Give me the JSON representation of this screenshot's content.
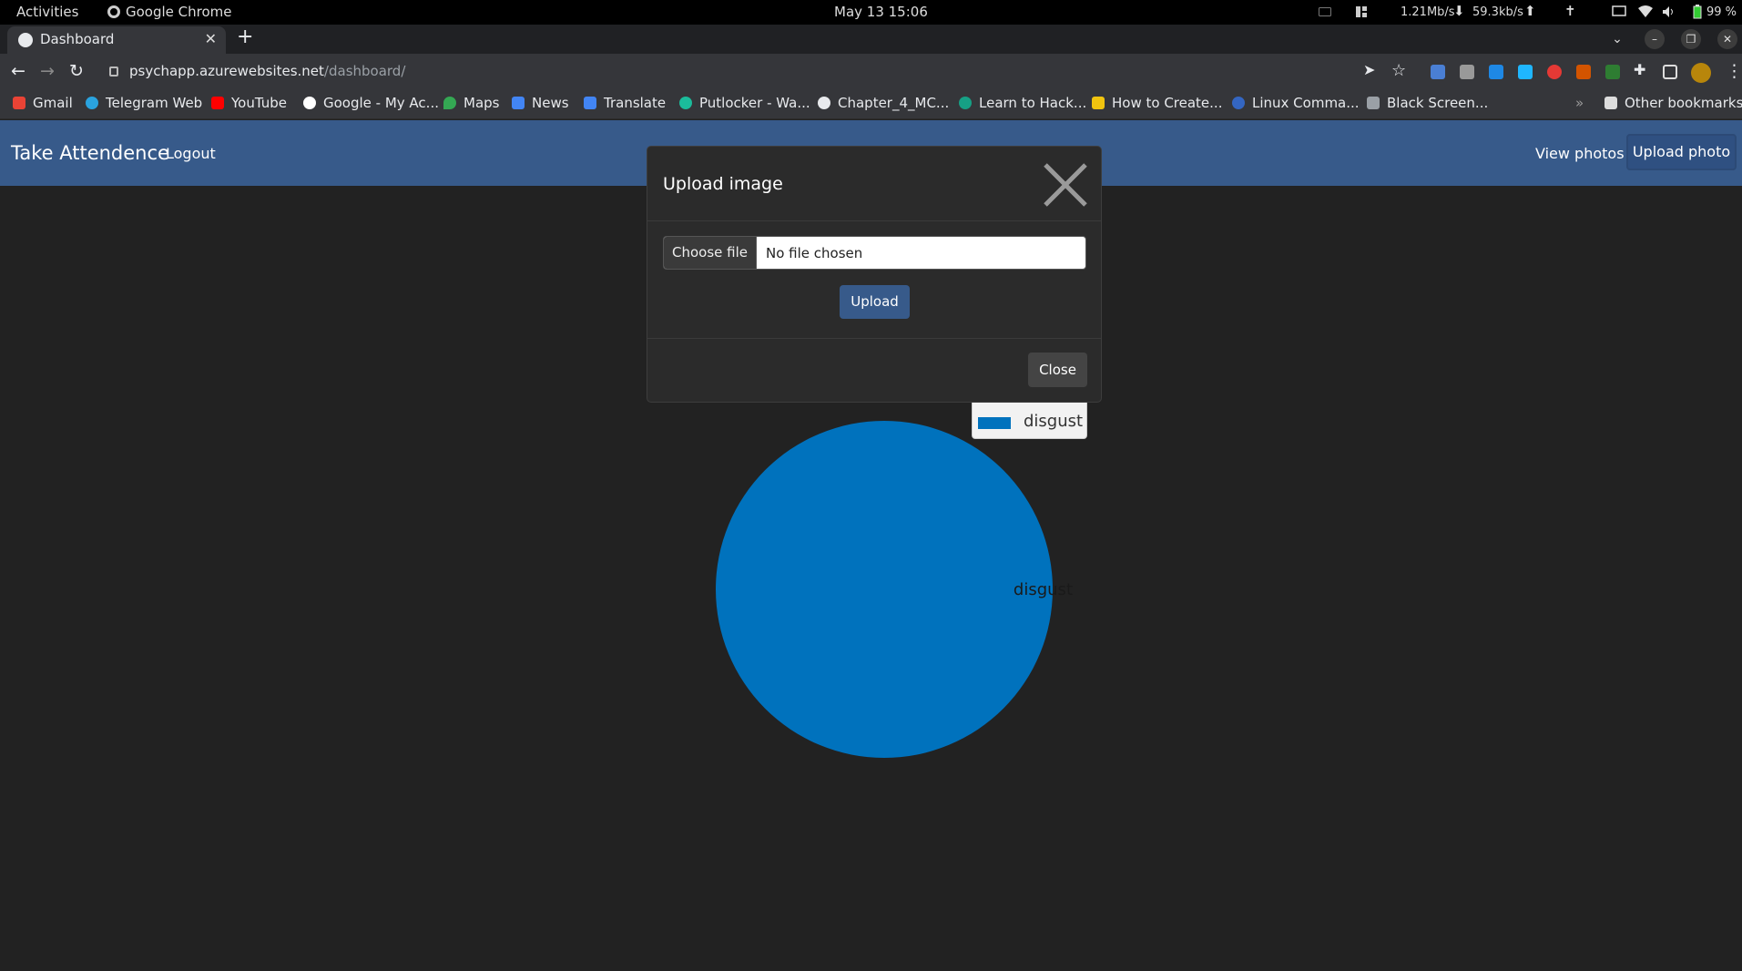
{
  "os": {
    "activities": "Activities",
    "app_name": "Google Chrome",
    "clock": "May 13  15:06",
    "net_down": "1.21Mb/s",
    "net_up": "59.3kb/s",
    "battery": "99 %"
  },
  "browser": {
    "tab_title": "Dashboard",
    "url_host": "psychapp.azurewebsites.net",
    "url_path": "/dashboard/",
    "bookmarks": [
      {
        "label": "Gmail",
        "color": "#ea4335"
      },
      {
        "label": "Telegram Web",
        "color": "#2aa3df"
      },
      {
        "label": "YouTube",
        "color": "#ff0000"
      },
      {
        "label": "Google - My Ac...",
        "color": "#ffffff"
      },
      {
        "label": "Maps",
        "color": "#34a853"
      },
      {
        "label": "News",
        "color": "#4285f4"
      },
      {
        "label": "Translate",
        "color": "#4285f4"
      },
      {
        "label": "Putlocker - Wa...",
        "color": "#1bbc9b"
      },
      {
        "label": "Chapter_4_MC...",
        "color": "#e8eaed"
      },
      {
        "label": "Learn to Hack...",
        "color": "#16a085"
      },
      {
        "label": "How to Create...",
        "color": "#f1c40f"
      },
      {
        "label": "Linux Comma...",
        "color": "#3466c2"
      },
      {
        "label": "Black Screen...",
        "color": "#9aa0a6"
      }
    ],
    "other_bookmarks": "Other bookmarks"
  },
  "app": {
    "brand": "Take Attendence",
    "logout": "Logout",
    "view_photos": "View photos",
    "upload_photo": "Upload photo"
  },
  "chart_data": {
    "type": "pie",
    "categories": [
      "disgust"
    ],
    "values": [
      1
    ],
    "colors": [
      "#0072bd"
    ],
    "slice_labels": [
      "disgust"
    ],
    "legend": [
      "disgust"
    ],
    "legend_position": "top-right"
  },
  "modal": {
    "title": "Upload image",
    "choose_file": "Choose file",
    "no_file": "No file chosen",
    "upload": "Upload",
    "close": "Close"
  }
}
